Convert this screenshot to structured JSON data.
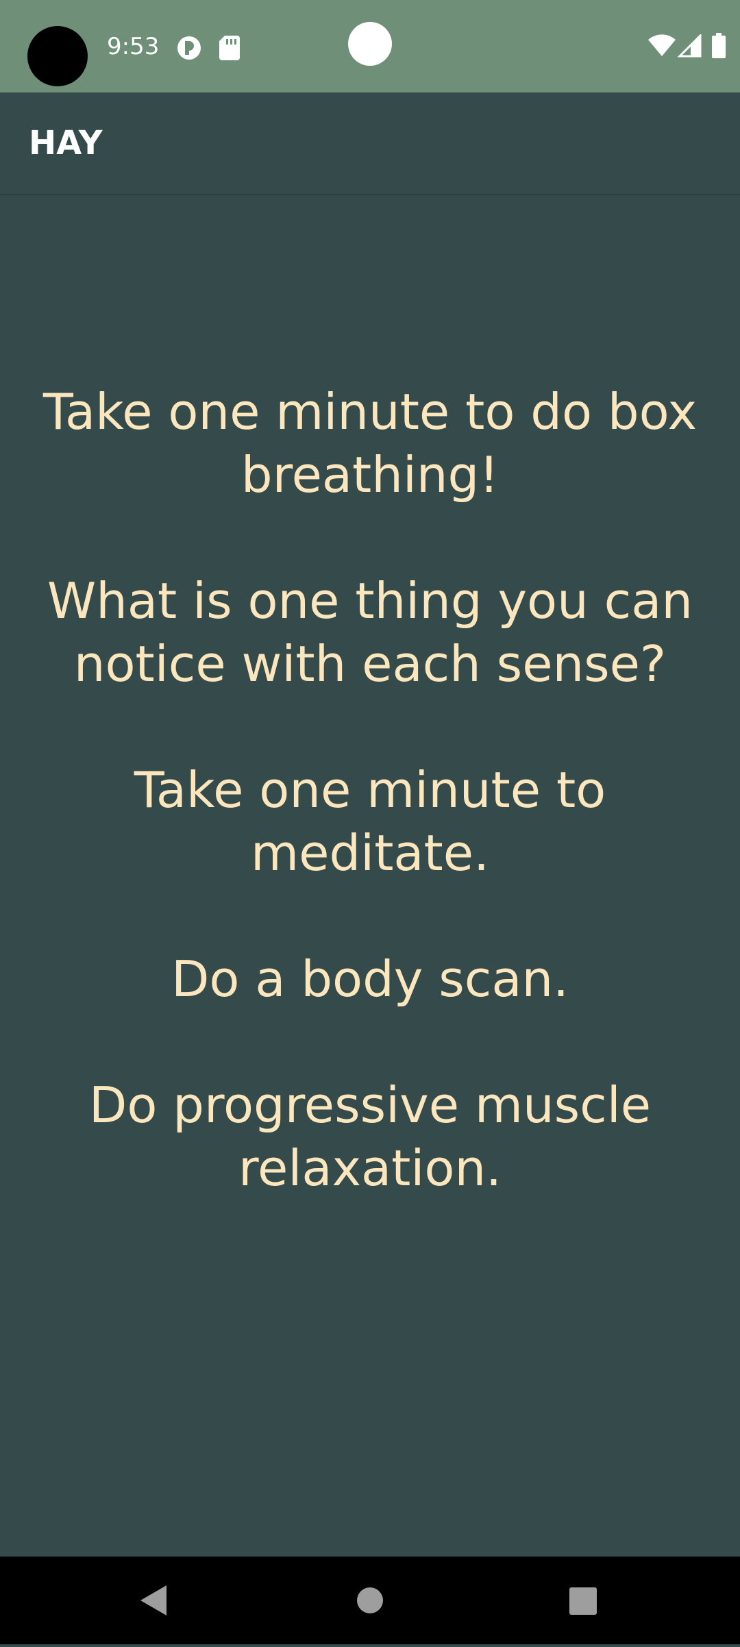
{
  "status_bar": {
    "time": "9:53",
    "icons": [
      "circle-p-icon",
      "sd-card-icon",
      "wifi-icon",
      "signal-icon",
      "battery-icon"
    ]
  },
  "app_bar": {
    "title": "HAY"
  },
  "prompts": [
    "Take one minute to do box breathing!",
    "What is one thing you can notice with each sense?",
    "Take one minute to meditate.",
    "Do a body scan.",
    "Do progressive muscle relaxation."
  ],
  "nav_bar": {
    "icons": [
      "back-icon",
      "home-icon",
      "recents-icon"
    ]
  },
  "colors": {
    "status_bar_bg": "#708f79",
    "app_bg": "#344a4b",
    "prompt_text": "#fbe6be",
    "title_text": "#ffffff"
  }
}
